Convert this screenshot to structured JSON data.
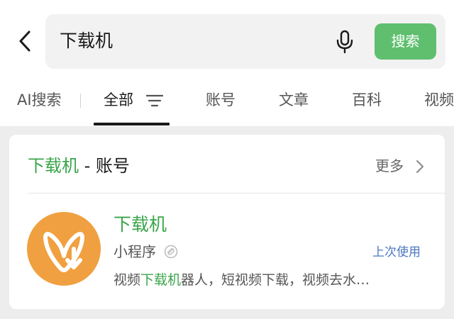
{
  "search": {
    "query": "下载机",
    "button_label": "搜索"
  },
  "tabs": [
    {
      "label": "AI搜索"
    },
    {
      "label": "全部",
      "active": true
    },
    {
      "label": "账号"
    },
    {
      "label": "文章"
    },
    {
      "label": "百科"
    },
    {
      "label": "视频"
    }
  ],
  "result_section": {
    "title_keyword": "下载机",
    "title_suffix": " - 账号",
    "more_label": "更多"
  },
  "result_item": {
    "name": "下载机",
    "type_label": "小程序",
    "recent_label": "上次使用",
    "description_prefix": "视频",
    "description_keyword": "下载机",
    "description_suffix": "器人，短视频下载，视频去水…",
    "logo_color": "#f0a040"
  },
  "colors": {
    "accent_green": "#3aa54a",
    "button_green": "#5fbf6e",
    "link_blue": "#4a78c0"
  },
  "icons": [
    "back-arrow-icon",
    "microphone-icon",
    "filter-icon",
    "chevron-right-icon",
    "link-icon",
    "app-logo-icon"
  ]
}
